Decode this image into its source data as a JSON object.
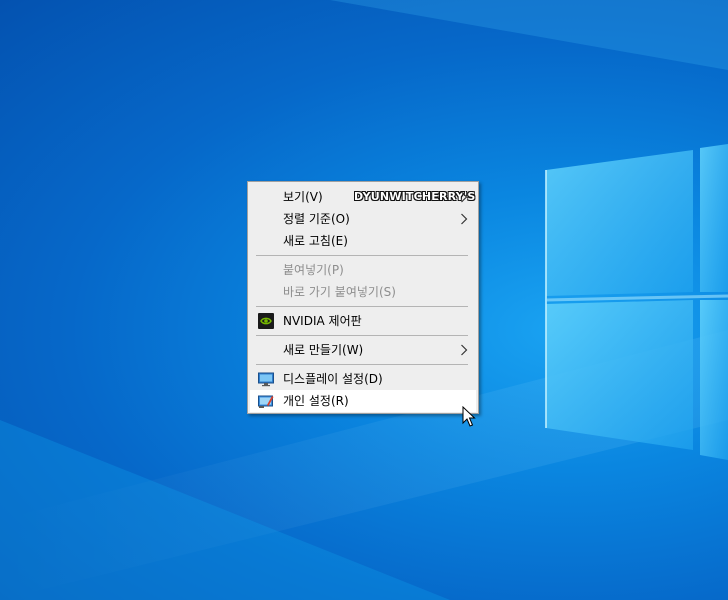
{
  "desktop": {
    "background_color": "#0a7fd8",
    "logo_color": "#4fc7f7"
  },
  "context_menu": {
    "watermark": "DYUNWITCHERRY'S",
    "items": [
      {
        "label": "보기(V)",
        "submenu": true,
        "enabled": true
      },
      {
        "label": "정렬 기준(O)",
        "submenu": true,
        "enabled": true
      },
      {
        "label": "새로 고침(E)",
        "submenu": false,
        "enabled": true
      },
      {
        "label": "붙여넣기(P)",
        "submenu": false,
        "enabled": false
      },
      {
        "label": "바로 가기 붙여넣기(S)",
        "submenu": false,
        "enabled": false
      },
      {
        "label": "NVIDIA 제어판",
        "icon": "nvidia-icon",
        "submenu": false,
        "enabled": true
      },
      {
        "label": "새로 만들기(W)",
        "submenu": true,
        "enabled": true
      },
      {
        "label": "디스플레이 설정(D)",
        "icon": "display-icon",
        "submenu": false,
        "enabled": true
      },
      {
        "label": "개인 설정(R)",
        "icon": "personalize-icon",
        "submenu": false,
        "enabled": true,
        "hovered": true
      }
    ]
  }
}
